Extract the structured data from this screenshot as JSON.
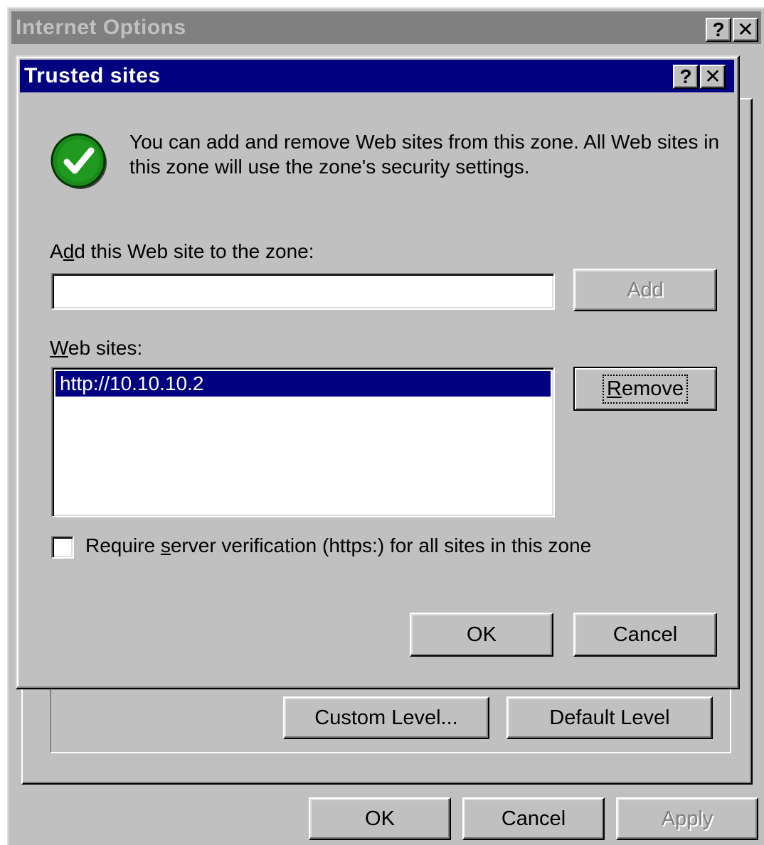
{
  "outer_window": {
    "title": "Internet Options",
    "help_glyph": "?",
    "close_glyph": "✕",
    "custom_level_label": "Custom Level...",
    "default_level_label": "Default Level",
    "ok_label": "OK",
    "cancel_label": "Cancel",
    "apply_label": "Apply"
  },
  "dialog": {
    "title": "Trusted sites",
    "help_glyph": "?",
    "close_glyph": "✕",
    "icon": "green-checkmark-icon",
    "description": "You can add and remove Web sites from this zone. All Web sites in this zone will use the zone's security settings.",
    "add_label": "Add this Web site to the zone:",
    "add_input_value": "",
    "add_button_label": "Add",
    "websites_label": "Web sites:",
    "websites": [
      "http://10.10.10.2"
    ],
    "remove_button_label": "Remove",
    "require_verification_label": "Require server verification (https:) for all sites in this zone",
    "require_verification_checked": false,
    "ok_label": "OK",
    "cancel_label": "Cancel"
  },
  "colors": {
    "title_active": "#000080",
    "title_inactive": "#808080",
    "face": "#c0c0c0",
    "selection": "#000080",
    "check_green": "#1a8a1a"
  }
}
